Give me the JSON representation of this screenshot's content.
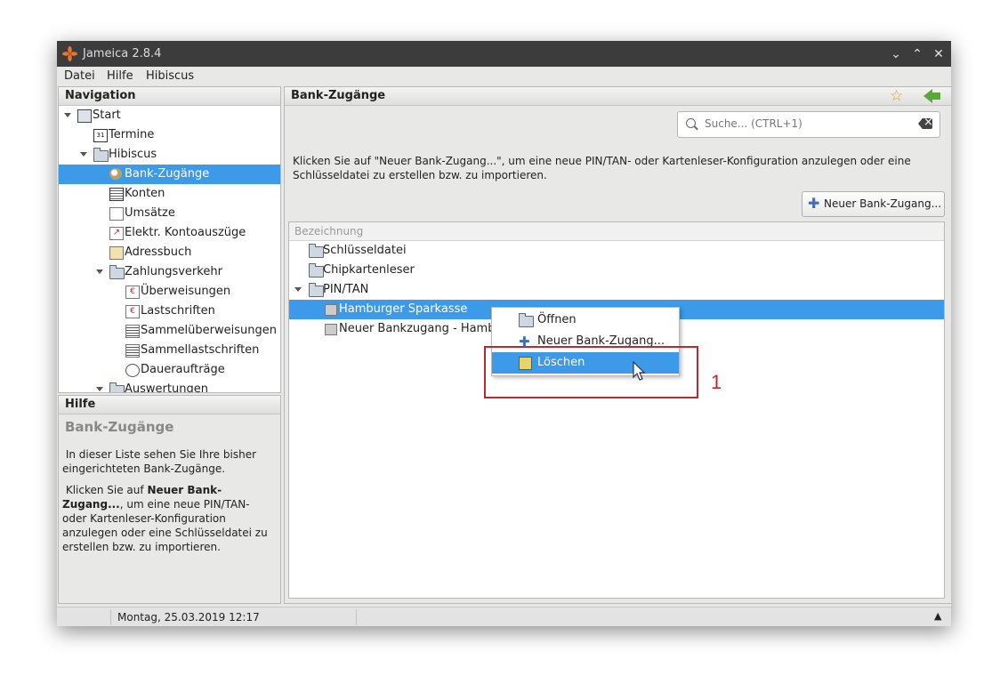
{
  "window": {
    "title": "Jameica 2.8.4"
  },
  "menu": [
    "Datei",
    "Hilfe",
    "Hibiscus"
  ],
  "navigation": {
    "title": "Navigation",
    "items": [
      {
        "label": "Start"
      },
      {
        "label": "Termine"
      },
      {
        "label": "Hibiscus"
      },
      {
        "label": "Bank-Zugänge"
      },
      {
        "label": "Konten"
      },
      {
        "label": "Umsätze"
      },
      {
        "label": "Elektr. Kontoauszüge"
      },
      {
        "label": "Adressbuch"
      },
      {
        "label": "Zahlungsverkehr"
      },
      {
        "label": "Überweisungen"
      },
      {
        "label": "Lastschriften"
      },
      {
        "label": "Sammelüberweisungen"
      },
      {
        "label": "Sammellastschriften"
      },
      {
        "label": "Daueraufträge"
      },
      {
        "label": "Auswertungen"
      }
    ]
  },
  "help": {
    "title": "Hilfe",
    "heading": "Bank-Zugänge",
    "p1": "In dieser Liste sehen Sie Ihre bisher eingerichteten Bank-Zugänge.",
    "p2_pre": "Klicken Sie auf ",
    "p2_bold": "Neuer Bank-Zugang...",
    "p2_post": ", um eine neue PIN/TAN- oder Kartenleser-Konfiguration anzulegen oder eine Schlüsseldatei zu erstellen bzw. zu importieren."
  },
  "main": {
    "title": "Bank-Zugänge",
    "search_placeholder": "Suche...  (CTRL+1)",
    "info": "Klicken Sie auf \"Neuer Bank-Zugang...\", um eine neue PIN/TAN- oder Kartenleser-Konfiguration anzulegen oder eine Schlüsseldatei zu erstellen bzw. zu importieren.",
    "new_button": "Neuer Bank-Zugang...",
    "column": "Bezeichnung",
    "rows": [
      {
        "label": "Schlüsseldatei"
      },
      {
        "label": "Chipkartenleser"
      },
      {
        "label": "PIN/TAN"
      },
      {
        "label": "Hamburger Sparkasse"
      },
      {
        "label": "Neuer Bankzugang - Hambu"
      }
    ]
  },
  "context_menu": {
    "items": [
      {
        "label": "Öffnen"
      },
      {
        "label": "Neuer Bank-Zugang..."
      },
      {
        "label": "Löschen"
      }
    ]
  },
  "annotation": {
    "number": "1"
  },
  "status": {
    "text": "Montag, 25.03.2019 12:17"
  },
  "colors": {
    "selection": "#3d9ae8",
    "annotation": "#c0282d",
    "titlebar": "#3c3c3c"
  }
}
